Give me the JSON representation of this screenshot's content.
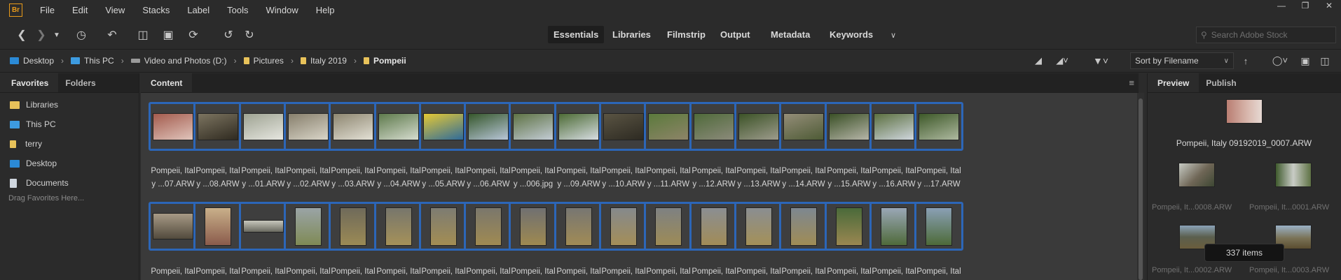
{
  "app": {
    "logo_text": "Br",
    "accent": "#e89a1a",
    "selection_color": "#2c66b8"
  },
  "menu": [
    "File",
    "Edit",
    "View",
    "Stacks",
    "Label",
    "Tools",
    "Window",
    "Help"
  ],
  "window_controls": [
    "minimize",
    "restore",
    "close"
  ],
  "workspaces": [
    "Essentials",
    "Libraries",
    "Filmstrip",
    "Output",
    "Metadata",
    "Keywords"
  ],
  "active_workspace": "Essentials",
  "search": {
    "placeholder": "Search Adobe Stock"
  },
  "breadcrumb": [
    {
      "label": "Desktop",
      "icon": "desktop-icon"
    },
    {
      "label": "This PC",
      "icon": "pc-icon"
    },
    {
      "label": "Video and Photos (D:)",
      "icon": "drive-icon"
    },
    {
      "label": "Pictures",
      "icon": "folder-icon"
    },
    {
      "label": "Italy 2019",
      "icon": "folder-icon"
    },
    {
      "label": "Pompeii",
      "icon": "folder-icon"
    }
  ],
  "sort": {
    "value": "Sort by Filename"
  },
  "left_panel": {
    "tabs": [
      "Favorites",
      "Folders"
    ],
    "items": [
      "Libraries",
      "This PC",
      "terry",
      "Desktop",
      "Documents"
    ],
    "drag_hint": "Drag Favorites Here..."
  },
  "content": {
    "tab": "Content",
    "row1": [
      [
        "Pompeii, Ital",
        "y ...07.ARW"
      ],
      [
        "Pompeii, Ital",
        "y ...08.ARW"
      ],
      [
        "Pompeii, Ital",
        "y ...01.ARW"
      ],
      [
        "Pompeii, Ital",
        "y ...02.ARW"
      ],
      [
        "Pompeii, Ital",
        "y ...03.ARW"
      ],
      [
        "Pompeii, Ital",
        "y ...04.ARW"
      ],
      [
        "Pompeii, Ital",
        "y ...05.ARW"
      ],
      [
        "Pompeii, Ital",
        "y ...06.ARW"
      ],
      [
        "Pompeii, Ital",
        "y ...006.jpg"
      ],
      [
        "Pompeii, Ital",
        "y ...09.ARW"
      ],
      [
        "Pompeii, Ital",
        "y ...10.ARW"
      ],
      [
        "Pompeii, Ital",
        "y ...11.ARW"
      ],
      [
        "Pompeii, Ital",
        "y ...12.ARW"
      ],
      [
        "Pompeii, Ital",
        "y ...13.ARW"
      ],
      [
        "Pompeii, Ital",
        "y ...14.ARW"
      ],
      [
        "Pompeii, Ital",
        "y ...15.ARW"
      ],
      [
        "Pompeii, Ital",
        "y ...16.ARW"
      ],
      [
        "Pompeii, Ital",
        "y ...17.ARW"
      ]
    ],
    "row2_caption": "Pompeii, Ital"
  },
  "right_panel": {
    "tabs": [
      "Preview",
      "Publish"
    ],
    "main_caption": "Pompeii, Italy 09192019_0007.ARW",
    "stack_captions": [
      "Pompeii, It...0008.ARW",
      "Pompeii, It...0001.ARW",
      "Pompeii, It...0002.ARW",
      "Pompeii, It...0003.ARW"
    ],
    "count": "337 items"
  }
}
